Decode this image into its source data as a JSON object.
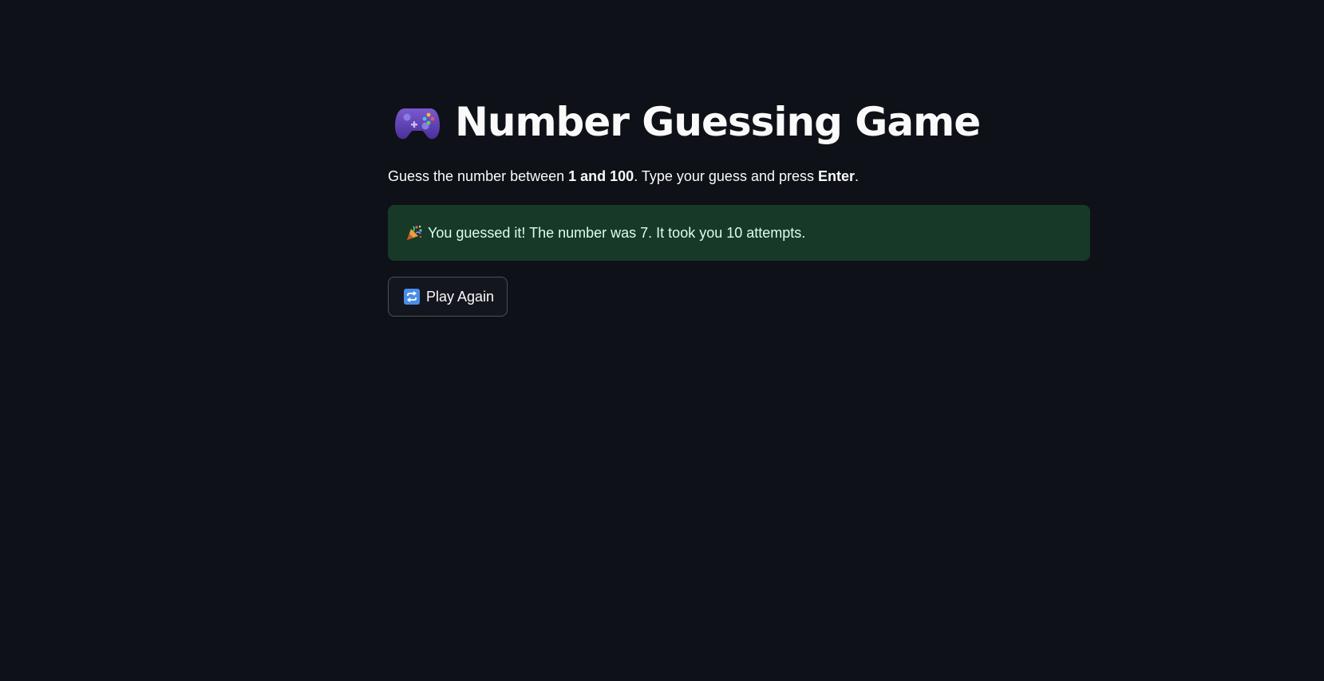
{
  "header": {
    "icon": "game-controller-icon",
    "title": "Number Guessing Game"
  },
  "instructions": {
    "part1": "Guess the number between ",
    "range": "1 and 100",
    "part2": ". Type your guess and press ",
    "key": "Enter",
    "part3": "."
  },
  "result": {
    "icon": "party-popper-icon",
    "message": "You guessed it! The number was 7. It took you 10 attempts.",
    "color": "#173928"
  },
  "actions": {
    "play_again_icon": "repeat-icon",
    "play_again_label": "Play Again"
  },
  "theme": {
    "background": "#0e1117",
    "text": "#fafafa"
  }
}
